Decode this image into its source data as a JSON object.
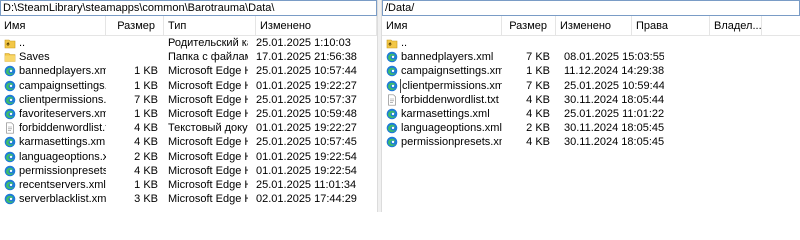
{
  "left_pane": {
    "path": "D:\\SteamLibrary\\steamapps\\common\\Barotrauma\\Data\\",
    "columns": {
      "name": "Имя",
      "size": "Размер",
      "type": "Тип",
      "modified": "Изменено"
    },
    "rows": [
      {
        "icon": "parent-folder-icon",
        "name": "..",
        "size": "",
        "type": "Родительский кат...",
        "modified": "25.01.2025 1:10:03"
      },
      {
        "icon": "folder-icon",
        "name": "Saves",
        "size": "",
        "type": "Папка с файлами",
        "modified": "17.01.2025 21:56:38"
      },
      {
        "icon": "edge-xml-icon",
        "name": "bannedplayers.xml",
        "size": "1 KB",
        "type": "Microsoft Edge H...",
        "modified": "25.01.2025 10:57:44"
      },
      {
        "icon": "edge-xml-icon",
        "name": "campaignsettings.xml",
        "size": "1 KB",
        "type": "Microsoft Edge H...",
        "modified": "01.01.2025 19:22:27"
      },
      {
        "icon": "edge-xml-icon",
        "name": "clientpermissions.xml",
        "size": "7 KB",
        "type": "Microsoft Edge H...",
        "modified": "25.01.2025 10:57:37"
      },
      {
        "icon": "edge-xml-icon",
        "name": "favoriteservers.xml",
        "size": "1 KB",
        "type": "Microsoft Edge H...",
        "modified": "25.01.2025 10:59:48"
      },
      {
        "icon": "text-file-icon",
        "name": "forbiddenwordlist.txt",
        "size": "4 KB",
        "type": "Текстовый докум...",
        "modified": "01.01.2025 19:22:27"
      },
      {
        "icon": "edge-xml-icon",
        "name": "karmasettings.xml",
        "size": "4 KB",
        "type": "Microsoft Edge H...",
        "modified": "25.01.2025 10:57:45"
      },
      {
        "icon": "edge-xml-icon",
        "name": "languageoptions.xml",
        "size": "2 KB",
        "type": "Microsoft Edge H...",
        "modified": "01.01.2025 19:22:54"
      },
      {
        "icon": "edge-xml-icon",
        "name": "permissionpresets.xml",
        "size": "4 KB",
        "type": "Microsoft Edge H...",
        "modified": "01.01.2025 19:22:54"
      },
      {
        "icon": "edge-xml-icon",
        "name": "recentservers.xml",
        "size": "1 KB",
        "type": "Microsoft Edge H...",
        "modified": "25.01.2025 11:01:34"
      },
      {
        "icon": "edge-xml-icon",
        "name": "serverblacklist.xml",
        "size": "3 KB",
        "type": "Microsoft Edge H...",
        "modified": "02.01.2025 17:44:29"
      }
    ]
  },
  "right_pane": {
    "path": "/Data/",
    "columns": {
      "name": "Имя",
      "size": "Размер",
      "modified": "Изменено",
      "rights": "Права",
      "owner": "Владел..."
    },
    "rows": [
      {
        "icon": "parent-folder-icon",
        "name": "..",
        "size": "",
        "modified": "",
        "focused": false
      },
      {
        "icon": "edge-xml-icon",
        "name": "bannedplayers.xml",
        "size": "7 KB",
        "modified": "08.01.2025 15:03:55",
        "focused": false
      },
      {
        "icon": "edge-xml-icon",
        "name": "campaignsettings.xml",
        "size": "1 KB",
        "modified": "11.12.2024 14:29:38",
        "focused": false
      },
      {
        "icon": "edge-xml-icon",
        "name": "clientpermissions.xml",
        "size": "7 KB",
        "modified": "25.01.2025 10:59:44",
        "focused": true
      },
      {
        "icon": "text-file-icon",
        "name": "forbiddenwordlist.txt",
        "size": "4 KB",
        "modified": "30.11.2024 18:05:44",
        "focused": false
      },
      {
        "icon": "edge-xml-icon",
        "name": "karmasettings.xml",
        "size": "4 KB",
        "modified": "25.01.2025 11:01:22",
        "focused": false
      },
      {
        "icon": "edge-xml-icon",
        "name": "languageoptions.xml",
        "size": "2 KB",
        "modified": "30.11.2024 18:05:45",
        "focused": false
      },
      {
        "icon": "edge-xml-icon",
        "name": "permissionpresets.xml",
        "size": "4 KB",
        "modified": "30.11.2024 18:05:45",
        "focused": false
      }
    ]
  },
  "colors": {
    "path_border": "#7a9cc6",
    "folder": "#f3c746",
    "edge_blue": "#1f7bd8",
    "edge_green": "#3ebd6a"
  }
}
